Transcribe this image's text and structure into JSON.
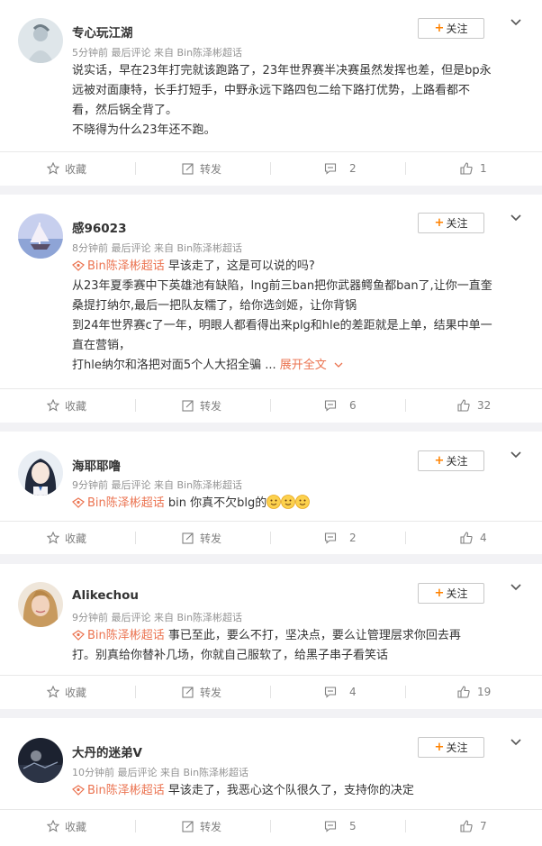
{
  "follow_label": "关注",
  "actions": {
    "favorite_label": "收藏",
    "repost_label": "转发"
  },
  "comments": [
    {
      "user": "专心玩江湖",
      "meta": "5分钟前  最后评论  来自 Bin陈泽彬超话",
      "lines": [
        "说实话，早在23年打完就该跑路了，23年世界赛半决赛虽然发挥也差，但是bp永",
        "远被对面康特，长手打短手，中野永远下路四包二给下路打优势，上路看都不",
        "看，然后锅全背了。",
        "不晓得为什么23年还不跑。"
      ],
      "comment_count": "2",
      "like_count": "1"
    },
    {
      "user": "感96023",
      "meta": "8分钟前  最后评论  来自 Bin陈泽彬超话",
      "tag": "Bin陈泽彬超话",
      "first_line": " 早该走了，这是可以说的吗?",
      "lines": [
        "从23年夏季赛中下英雄池有缺陷，lng前三ban把你武器鳄鱼都ban了,让你一直奎",
        "桑提打纳尔,最后一把队友糯了，给你选剑姬，让你背锅",
        "到24年世界赛c了一年，明眼人都看得出来plg和hle的差距就是上单，结果中单一",
        "直在营销，"
      ],
      "last_line": "打hle纳尔和洛把对面5个人大招全骗 ...",
      "more_label": "展开全文",
      "comment_count": "6",
      "like_count": "32"
    },
    {
      "user": "海耶耶噜",
      "meta": "9分钟前  最后评论  来自 Bin陈泽彬超话",
      "tag": "Bin陈泽彬超话",
      "text": " bin 你真不欠blg的",
      "comment_count": "2",
      "like_count": "4"
    },
    {
      "user": "Alikechou",
      "meta": "9分钟前  最后评论  来自 Bin陈泽彬超话",
      "tag": "Bin陈泽彬超话",
      "first_line": " 事已至此，要么不打，坚决点，要么让管理层求你回去再",
      "lines": [
        "打。别真给你替补几场，你就自己服软了，给黑子串子看笑话"
      ],
      "comment_count": "4",
      "like_count": "19"
    },
    {
      "user": "大丹的迷弟V",
      "meta": "10分钟前  最后评论  来自 Bin陈泽彬超话",
      "tag": "Bin陈泽彬超话",
      "text": " 早该走了，我恶心这个队很久了，支持你的决定",
      "comment_count": "5",
      "like_count": "7"
    }
  ],
  "colors": {
    "accent": "#ff8200",
    "tag": "#eb7350",
    "meta": "#939393"
  }
}
